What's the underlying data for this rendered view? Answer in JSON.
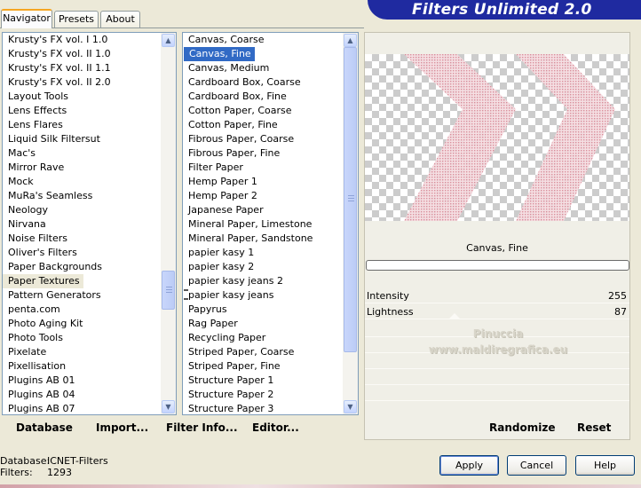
{
  "banner": {
    "title": "Filters Unlimited 2.0"
  },
  "tabs": [
    {
      "label": "Navigator",
      "active": true
    },
    {
      "label": "Presets",
      "active": false
    },
    {
      "label": "About",
      "active": false
    }
  ],
  "categories": {
    "items": [
      "Krusty's FX vol. I 1.0",
      "Krusty's FX vol. II 1.0",
      "Krusty's FX vol. II 1.1",
      "Krusty's FX vol. II 2.0",
      "Layout Tools",
      "Lens Effects",
      "Lens Flares",
      "Liquid Silk Filtersut",
      "Mac's",
      "Mirror Rave",
      "Mock",
      "MuRa's Seamless",
      "Neology",
      "Nirvana",
      "Noise Filters",
      "Oliver's Filters",
      "Paper Backgrounds",
      "Paper Textures",
      "Pattern Generators",
      "penta.com",
      "Photo Aging Kit",
      "Photo Tools",
      "Pixelate",
      "Pixellisation",
      "Plugins AB 01",
      "Plugins AB 04",
      "Plugins AB 07"
    ],
    "selected": "Paper Textures"
  },
  "filters": {
    "items": [
      "Canvas, Coarse",
      "Canvas, Fine",
      "Canvas, Medium",
      "Cardboard Box, Coarse",
      "Cardboard Box, Fine",
      "Cotton Paper, Coarse",
      "Cotton Paper, Fine",
      "Fibrous Paper, Coarse",
      "Fibrous Paper, Fine",
      "Filter Paper",
      "Hemp Paper 1",
      "Hemp Paper 2",
      "Japanese Paper",
      "Mineral Paper, Limestone",
      "Mineral Paper, Sandstone",
      "papier kasy 1",
      "papier kasy 2",
      "papier kasy jeans 2",
      "papier kasy jeans",
      "Papyrus",
      "Rag Paper",
      "Recycling Paper",
      "Striped Paper, Coarse",
      "Striped Paper, Fine",
      "Structure Paper 1",
      "Structure Paper 2",
      "Structure Paper 3"
    ],
    "selected": "Canvas, Fine"
  },
  "preview": {
    "filter_name": "Canvas, Fine",
    "progress": 0,
    "watermark_line1": "Pinuccia",
    "watermark_line2": "www.maldiregrafica.eu"
  },
  "params": [
    {
      "label": "Intensity",
      "value": "255"
    },
    {
      "label": "Lightness",
      "value": "87"
    }
  ],
  "bottom_links": {
    "database": "Database",
    "import": "Import...",
    "filter_info": "Filter Info...",
    "editor": "Editor...",
    "randomize": "Randomize",
    "reset": "Reset"
  },
  "status": {
    "database_label": "Database:",
    "database_value": "ICNET-Filters",
    "filters_label": "Filters:",
    "filters_value": "1293"
  },
  "buttons": {
    "apply": "Apply",
    "cancel": "Cancel",
    "help": "Help"
  },
  "colors": {
    "banner": "#1f2aa0",
    "selection": "#316ac5",
    "preview_pattern": "#e2aab3"
  }
}
